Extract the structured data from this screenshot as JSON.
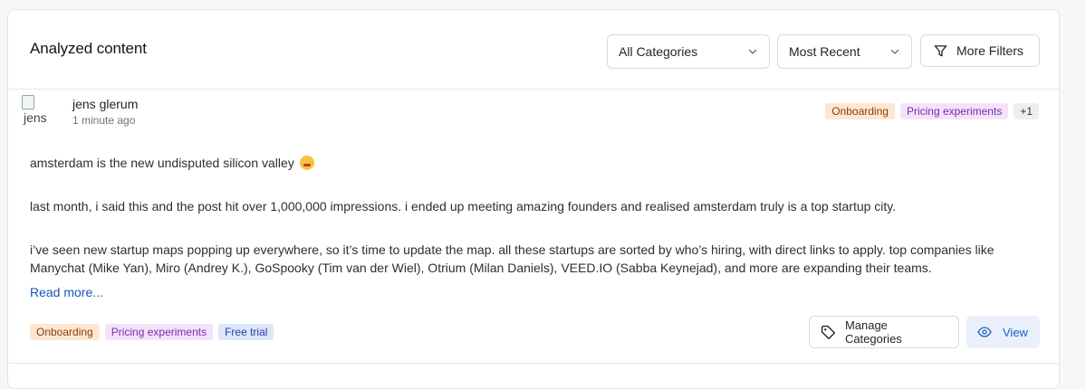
{
  "header": {
    "title": "Analyzed content",
    "category_select": "All Categories",
    "sort_select": "Most Recent",
    "more_filters_label": "More Filters"
  },
  "post": {
    "avatar_alt": "jens",
    "author": "jens glerum",
    "time": "1 minute ago",
    "top_tags": [
      "Onboarding",
      "Pricing experiments",
      "+1"
    ],
    "paragraphs": [
      "amsterdam is the new undisputed silicon valley",
      "last month, i said this and the post hit over 1,000,000 impressions. i ended up meeting amazing founders and realised amsterdam truly is a top startup city.",
      "i’ve seen new startup maps popping up everywhere, so it’s time to update the map. all these startups are sorted by who’s hiring, with direct links to apply. top companies like Manychat (Mike Yan), Miro (Andrey K.), GoSpooky (Tim van der Wiel), Otrium (Milan Daniels), VEED.IO (Sabba Keynejad), and more are expanding their teams."
    ],
    "read_more": "Read more...",
    "bottom_tags": [
      "Onboarding",
      "Pricing experiments",
      "Free trial"
    ],
    "manage_label": "Manage Categories",
    "view_label": "View"
  },
  "colors": {
    "accent": "#1c5fc4",
    "tag_onboarding_bg": "#fde7d2",
    "tag_pricing_bg": "#f3e3fa",
    "tag_trial_bg": "#dde6fb"
  },
  "icons": [
    "chevron-down-icon",
    "filter-icon",
    "tag-icon",
    "eye-icon",
    "emoji-icon"
  ]
}
